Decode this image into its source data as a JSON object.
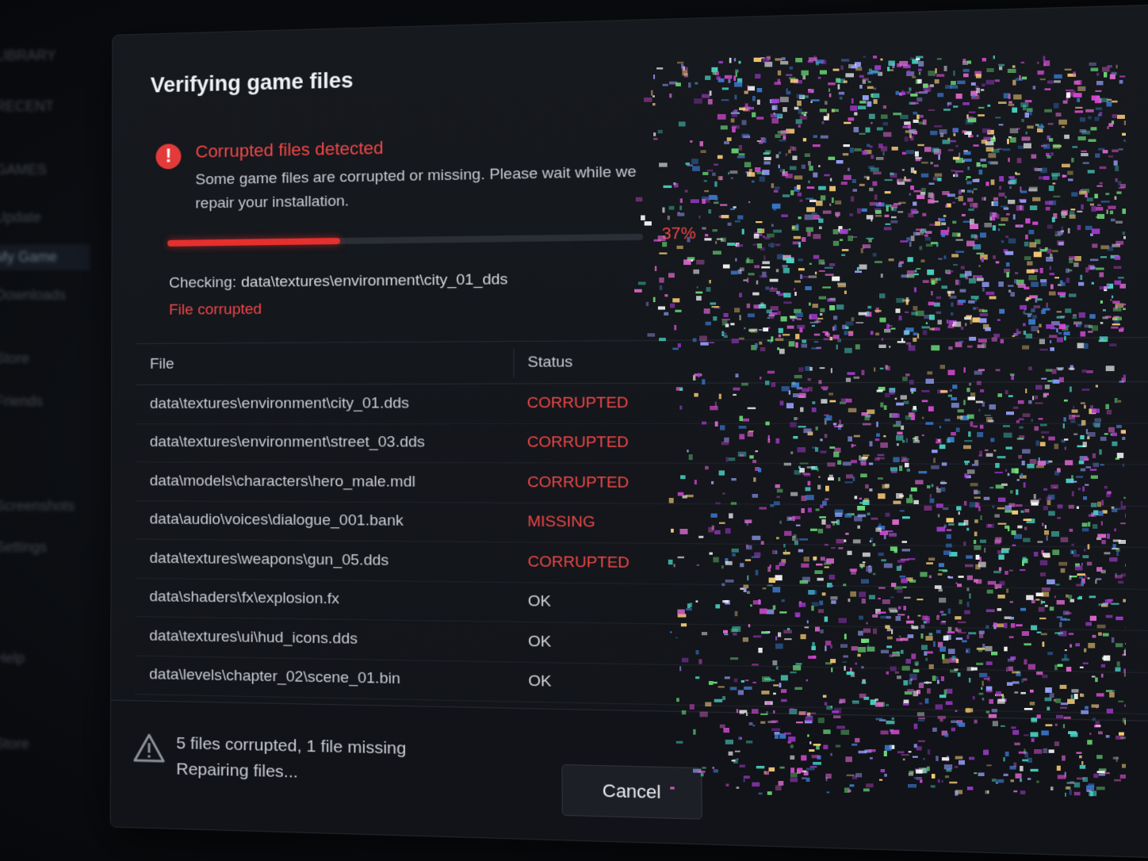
{
  "window": {
    "minimize_glyph": "–",
    "close_glyph": "✕"
  },
  "sidebar": {
    "items": [
      "LIBRARY",
      "RECENT",
      "GAMES",
      "Update",
      "My Game",
      "Downloads",
      "Store",
      "Friends",
      "Screenshots",
      "Settings",
      "Help",
      "Store"
    ],
    "active_index": 4
  },
  "dialog": {
    "title": "Verifying game files",
    "alert_glyph": "!",
    "alert_title": "Corrupted files detected",
    "alert_desc": "Some game files are corrupted or missing. Please wait while we repair your installation.",
    "progress": {
      "percent": 37,
      "label": "37%"
    },
    "checking_label": "Checking:",
    "checking_path": "data\\textures\\environment\\city_01_dds",
    "file_state": "File corrupted"
  },
  "table": {
    "columns": [
      "File",
      "Status"
    ],
    "rows": [
      {
        "file": "data\\textures\\environment\\city_01.dds",
        "status": "CORRUPTED"
      },
      {
        "file": "data\\textures\\environment\\street_03.dds",
        "status": "CORRUPTED"
      },
      {
        "file": "data\\models\\characters\\hero_male.mdl",
        "status": "CORRUPTED"
      },
      {
        "file": "data\\audio\\voices\\dialogue_001.bank",
        "status": "MISSING"
      },
      {
        "file": "data\\textures\\weapons\\gun_05.dds",
        "status": "CORRUPTED"
      },
      {
        "file": "data\\shaders\\fx\\explosion.fx",
        "status": "OK"
      },
      {
        "file": "data\\textures\\ui\\hud_icons.dds",
        "status": "OK"
      },
      {
        "file": "data\\levels\\chapter_02\\scene_01.bin",
        "status": "OK"
      }
    ]
  },
  "footer": {
    "summary": "5 files corrupted, 1 file missing",
    "state": "Repairing files...",
    "cancel_label": "Cancel"
  },
  "colors": {
    "accent_red": "#f04747",
    "progress_red": "#e5302e",
    "bg": "#07090c",
    "dialog_bg": "#16191e"
  },
  "icons": {
    "alert": "exclamation-circle-icon",
    "warning": "warning-triangle-icon",
    "close": "close-icon",
    "minimize": "minimize-icon"
  }
}
